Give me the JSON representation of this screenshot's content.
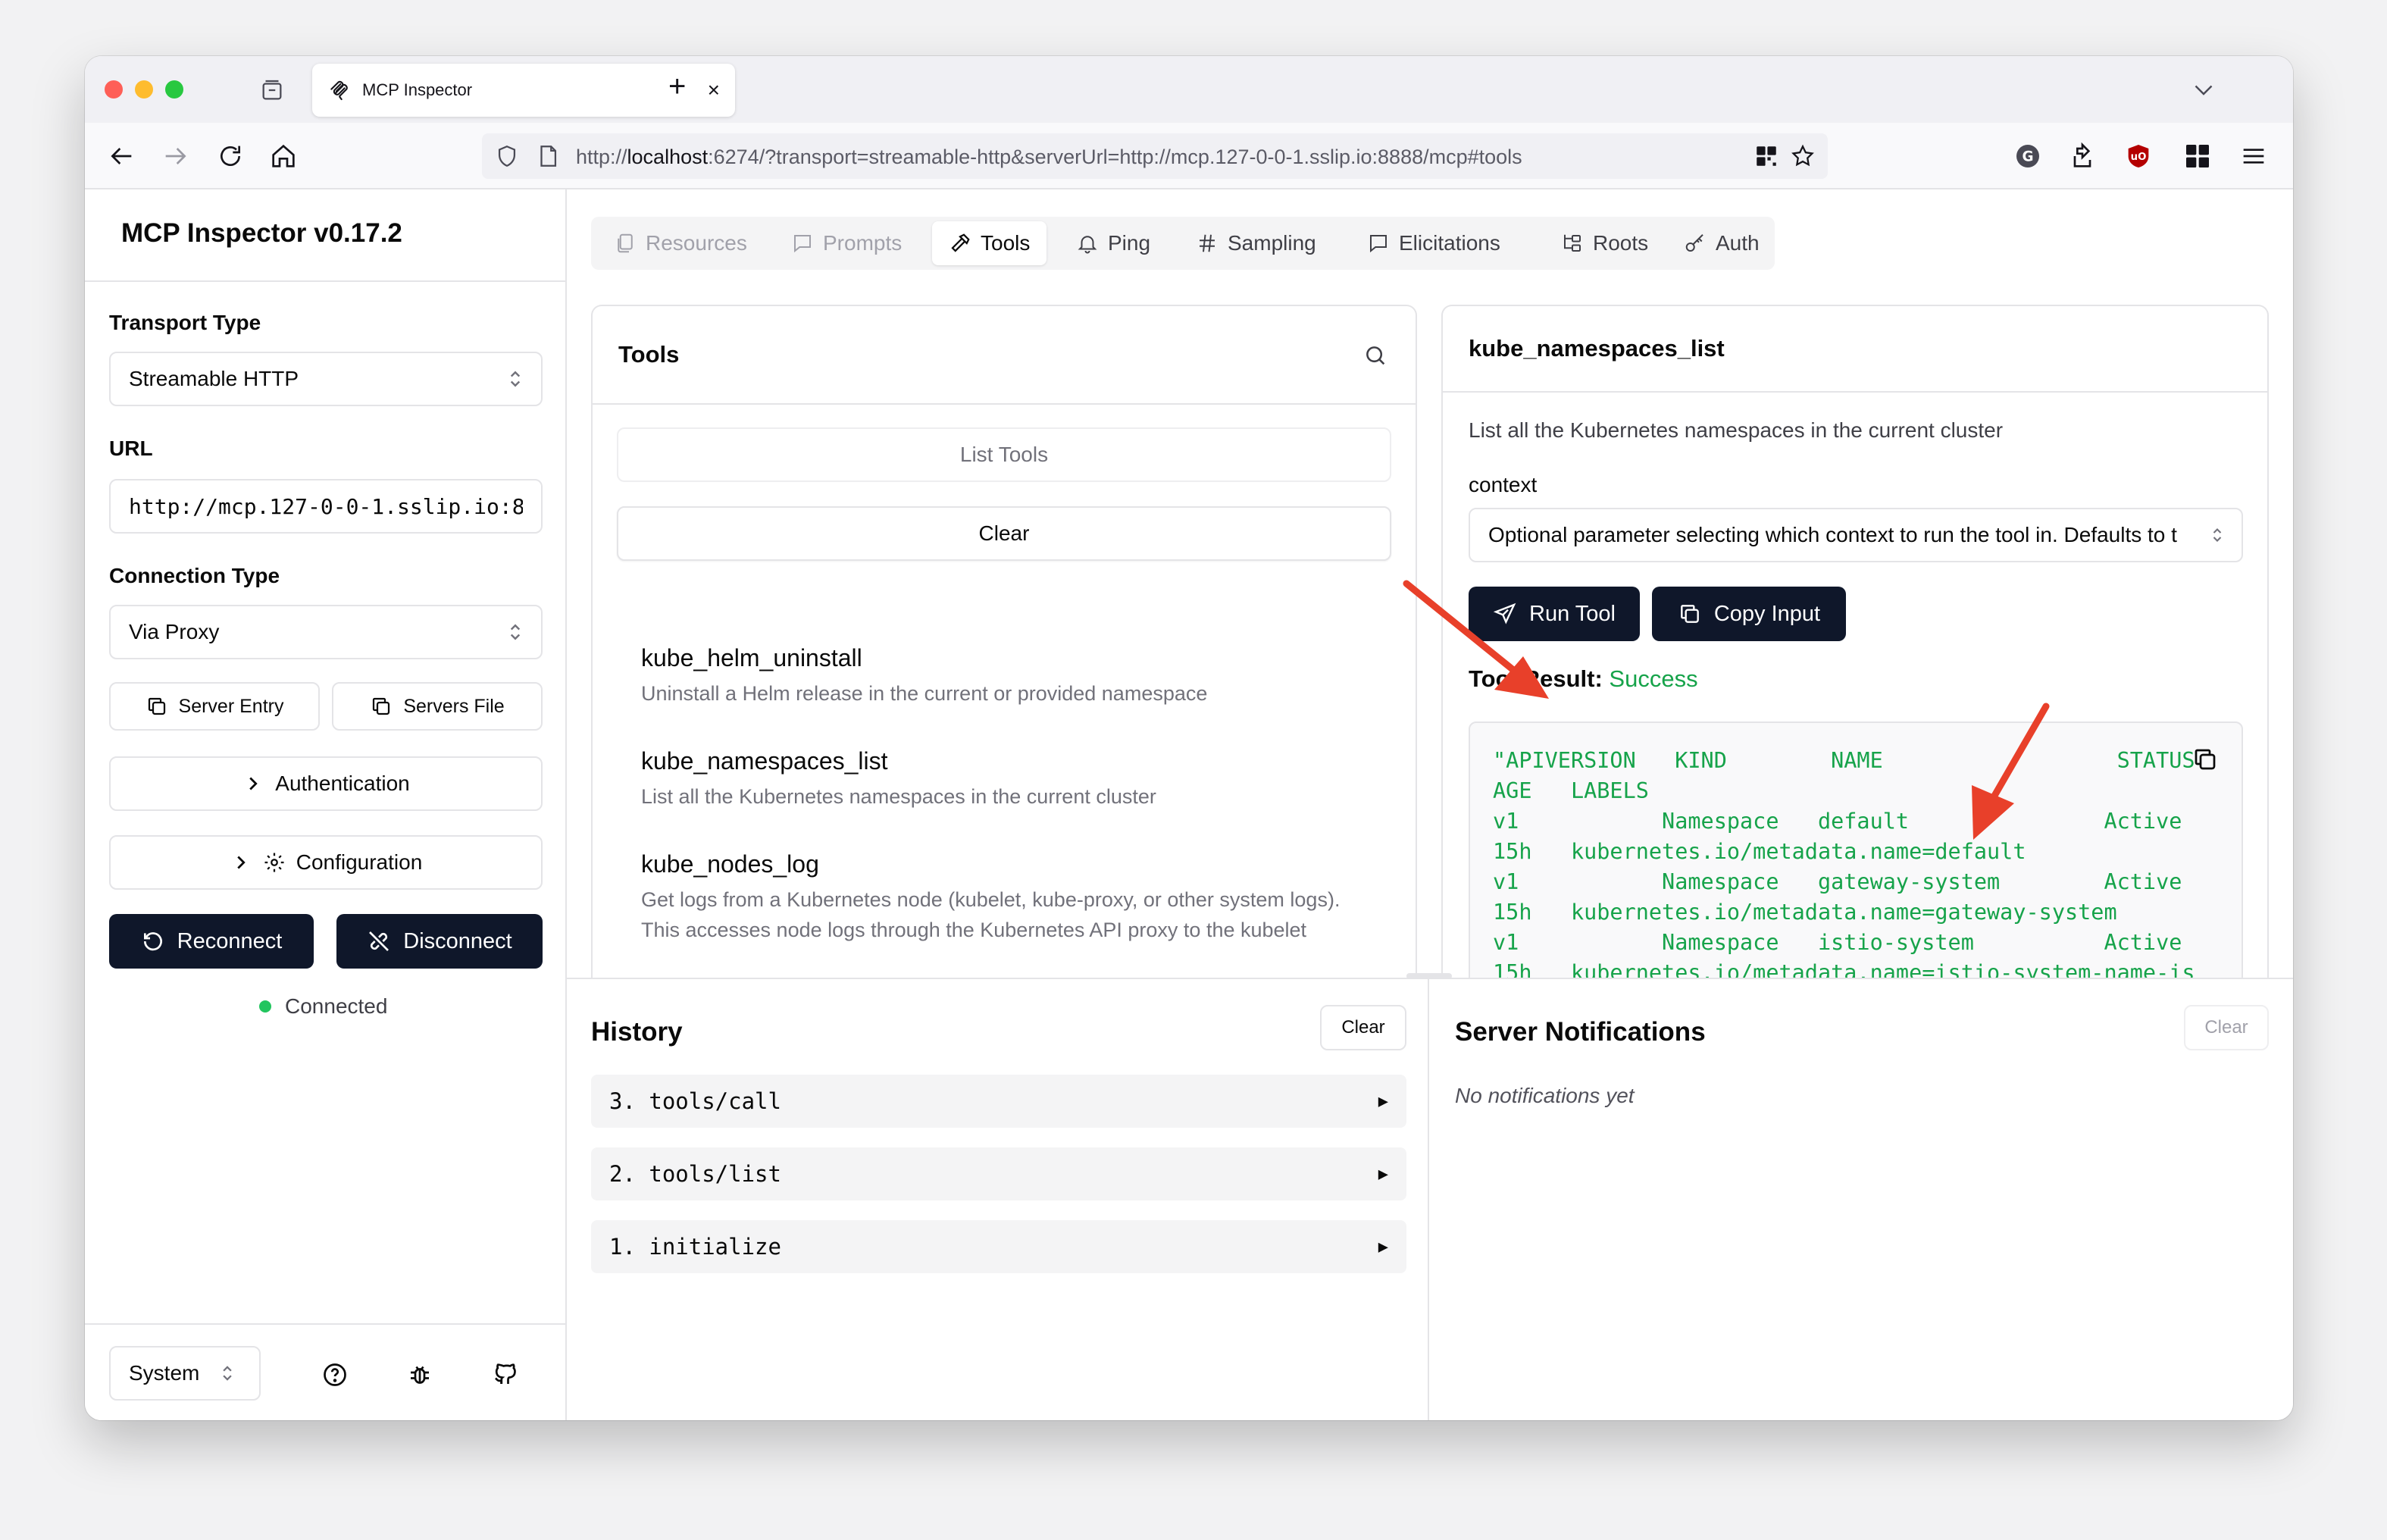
{
  "browser": {
    "tab_title": "MCP Inspector",
    "url_prefix": "http://",
    "url_host": "localhost",
    "url_rest": ":6274/?transport=streamable-http&serverUrl=http://mcp.127-0-0-1.sslip.io:8888/mcp#tools"
  },
  "sidebar": {
    "title": "MCP Inspector v0.17.2",
    "transport_label": "Transport Type",
    "transport_value": "Streamable HTTP",
    "url_label": "URL",
    "url_value": "http://mcp.127-0-0-1.sslip.io:8",
    "connection_label": "Connection Type",
    "connection_value": "Via Proxy",
    "server_entry": "Server Entry",
    "servers_file": "Servers File",
    "authentication": "Authentication",
    "configuration": "Configuration",
    "reconnect": "Reconnect",
    "disconnect": "Disconnect",
    "status": "Connected",
    "theme_value": "System"
  },
  "tabs": [
    {
      "label": "Resources",
      "icon": "files-icon"
    },
    {
      "label": "Prompts",
      "icon": "message-icon"
    },
    {
      "label": "Tools",
      "icon": "hammer-icon"
    },
    {
      "label": "Ping",
      "icon": "bell-icon"
    },
    {
      "label": "Sampling",
      "icon": "hash-icon"
    },
    {
      "label": "Elicitations",
      "icon": "message-square-icon"
    },
    {
      "label": "Roots",
      "icon": "folder-tree-icon"
    },
    {
      "label": "Auth",
      "icon": "key-icon"
    }
  ],
  "tools_panel": {
    "title": "Tools",
    "list_tools": "List Tools",
    "clear": "Clear",
    "items": [
      {
        "name": "kube_helm_uninstall",
        "desc": "Uninstall a Helm release in the current or provided namespace"
      },
      {
        "name": "kube_namespaces_list",
        "desc": "List all the Kubernetes namespaces in the current cluster"
      },
      {
        "name": "kube_nodes_log",
        "desc": "Get logs from a Kubernetes node (kubelet, kube-proxy, or other system logs). This accesses node logs through the Kubernetes API proxy to the kubelet"
      }
    ]
  },
  "detail_panel": {
    "title": "kube_namespaces_list",
    "description": "List all the Kubernetes namespaces in the current cluster",
    "param_label": "context",
    "param_placeholder": "Optional parameter selecting which context to run the tool in. Defaults to t",
    "run_tool": "Run Tool",
    "copy_input": "Copy Input",
    "result_label": "Tool Result:",
    "result_status": "Success",
    "result_lines": [
      "\"APIVERSION   KIND        NAME                  STATUS",
      "AGE   LABELS",
      "v1           Namespace   default               Active",
      "15h   kubernetes.io/metadata.name=default",
      "v1           Namespace   gateway-system        Active",
      "15h   kubernetes.io/metadata.name=gateway-system",
      "v1           Namespace   istio-system          Active",
      "15h   kubernetes.io/metadata.name=istio-system-name-is"
    ]
  },
  "history": {
    "title": "History",
    "clear": "Clear",
    "items": [
      "3. tools/call",
      "2. tools/list",
      "1. initialize"
    ]
  },
  "notifications": {
    "title": "Server Notifications",
    "clear": "Clear",
    "empty": "No notifications yet"
  },
  "colors": {
    "dark_button": "#0f172a",
    "success": "#16a34a",
    "annotation_arrow": "#e8402a"
  }
}
